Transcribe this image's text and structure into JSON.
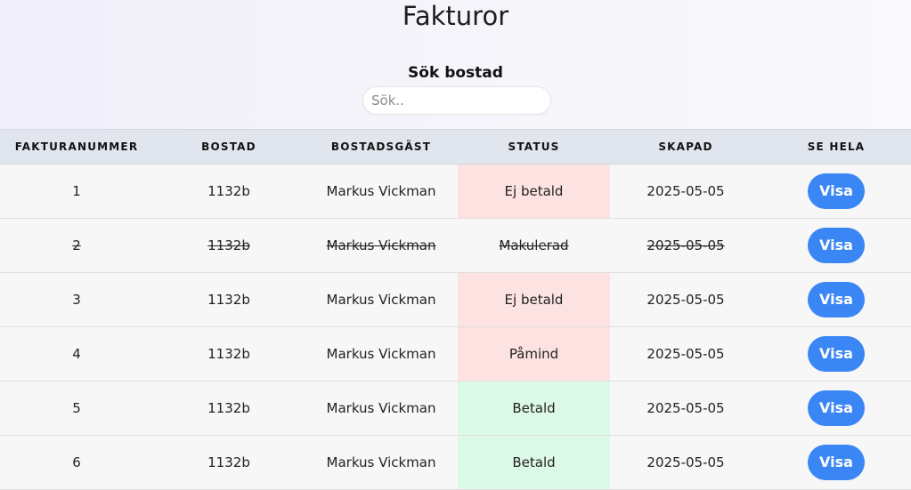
{
  "page": {
    "title": "Fakturor"
  },
  "search": {
    "label": "Sök bostad",
    "placeholder": "Sök..",
    "value": ""
  },
  "colors": {
    "accent": "#3a86f5",
    "unpaid_bg": "#fde2e2",
    "paid_bg": "#dcf8e6",
    "header_bg": "#e1e6ee"
  },
  "table": {
    "columns": [
      "FAKTURANUMMER",
      "BOSTAD",
      "BOSTADSGÄST",
      "STATUS",
      "SKAPAD",
      "SE HELA"
    ],
    "rows": [
      {
        "number": "1",
        "property": "1132b",
        "guest": "Markus Vickman",
        "status": "Ej betald",
        "created": "2025-05-05",
        "action": "Visa"
      },
      {
        "number": "2",
        "property": "1132b",
        "guest": "Markus Vickman",
        "status": "Makulerad",
        "created": "2025-05-05",
        "action": "Visa"
      },
      {
        "number": "3",
        "property": "1132b",
        "guest": "Markus Vickman",
        "status": "Ej betald",
        "created": "2025-05-05",
        "action": "Visa"
      },
      {
        "number": "4",
        "property": "1132b",
        "guest": "Markus Vickman",
        "status": "Påmind",
        "created": "2025-05-05",
        "action": "Visa"
      },
      {
        "number": "5",
        "property": "1132b",
        "guest": "Markus Vickman",
        "status": "Betald",
        "created": "2025-05-05",
        "action": "Visa"
      },
      {
        "number": "6",
        "property": "1132b",
        "guest": "Markus Vickman",
        "status": "Betald",
        "created": "2025-05-05",
        "action": "Visa"
      }
    ]
  }
}
